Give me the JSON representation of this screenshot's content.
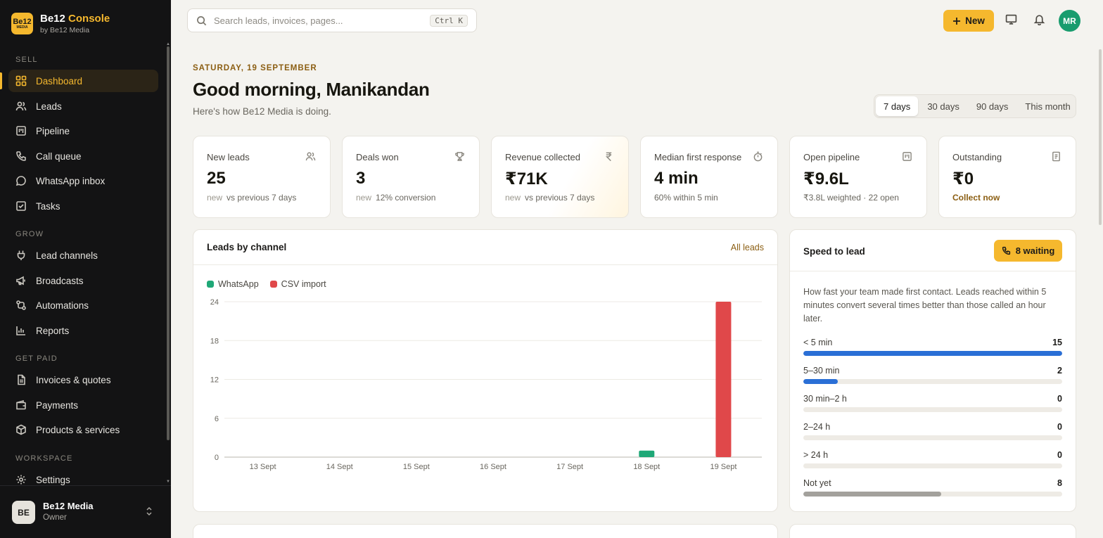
{
  "brand": {
    "name_prefix": "Be12",
    "name_suffix": "Console",
    "subtitle": "by Be12 Media",
    "logo_text": "Be12",
    "logo_subtext": "MEDIA"
  },
  "sidebar": {
    "sections": [
      {
        "label": "SELL"
      },
      {
        "label": "GROW"
      },
      {
        "label": "GET PAID"
      },
      {
        "label": "WORKSPACE"
      }
    ],
    "items": [
      {
        "label": "Dashboard",
        "icon": "grid-icon",
        "active": true
      },
      {
        "label": "Leads",
        "icon": "users-icon"
      },
      {
        "label": "Pipeline",
        "icon": "kanban-icon"
      },
      {
        "label": "Call queue",
        "icon": "phone-icon"
      },
      {
        "label": "WhatsApp inbox",
        "icon": "chat-bubble-icon"
      },
      {
        "label": "Tasks",
        "icon": "checkbox-icon"
      },
      {
        "label": "Lead channels",
        "icon": "plug-icon"
      },
      {
        "label": "Broadcasts",
        "icon": "megaphone-icon"
      },
      {
        "label": "Automations",
        "icon": "workflow-icon"
      },
      {
        "label": "Reports",
        "icon": "bar-chart-icon"
      },
      {
        "label": "Invoices & quotes",
        "icon": "document-icon"
      },
      {
        "label": "Payments",
        "icon": "wallet-icon"
      },
      {
        "label": "Products & services",
        "icon": "box-icon"
      },
      {
        "label": "Settings",
        "icon": "gear-icon"
      }
    ],
    "footer": {
      "avatar": "BE",
      "org": "Be12 Media",
      "role": "Owner"
    }
  },
  "topbar": {
    "search_placeholder": "Search leads, invoices, pages...",
    "shortcut": "Ctrl K",
    "new_label": "New",
    "avatar": "MR"
  },
  "header": {
    "date": "SATURDAY, 19 SEPTEMBER",
    "greeting": "Good morning, Manikandan",
    "subtitle": "Here's how Be12 Media is doing.",
    "ranges": [
      "7 days",
      "30 days",
      "90 days",
      "This month"
    ],
    "selected_range": "7 days"
  },
  "kpis": [
    {
      "title": "New leads",
      "value": "25",
      "note_muted": "new",
      "note": "vs previous 7 days",
      "icon": "users-icon"
    },
    {
      "title": "Deals won",
      "value": "3",
      "note_muted": "new",
      "note": "12% conversion",
      "icon": "trophy-icon"
    },
    {
      "title": "Revenue collected",
      "value": "₹71K",
      "note_muted": "new",
      "note": "vs previous 7 days",
      "icon": "rupee-icon"
    },
    {
      "title": "Median first response",
      "value": "4 min",
      "note_muted": "",
      "note": "60% within 5 min",
      "icon": "stopwatch-icon"
    },
    {
      "title": "Open pipeline",
      "value": "₹9.6L",
      "note_muted": "",
      "note": "₹3.8L weighted · 22 open",
      "icon": "kanban-icon"
    },
    {
      "title": "Outstanding",
      "value": "₹0",
      "note_muted": "",
      "note": "Collect now",
      "icon": "receipt-icon"
    }
  ],
  "leads_panel": {
    "title": "Leads by channel",
    "link": "All leads"
  },
  "chart_data": {
    "type": "bar",
    "categories": [
      "13 Sept",
      "14 Sept",
      "15 Sept",
      "16 Sept",
      "17 Sept",
      "18 Sept",
      "19 Sept"
    ],
    "series": [
      {
        "name": "WhatsApp",
        "color": "#1fa877",
        "values": [
          0,
          0,
          0,
          0,
          0,
          1,
          0
        ]
      },
      {
        "name": "CSV import",
        "color": "#e0484a",
        "values": [
          0,
          0,
          0,
          0,
          0,
          0,
          24
        ]
      }
    ],
    "yticks": [
      "0",
      "6",
      "12",
      "18",
      "24"
    ],
    "ylim": [
      0,
      24
    ],
    "grid": true,
    "legend": "top-left"
  },
  "speed_panel": {
    "title": "Speed to lead",
    "waiting_label": "8 waiting",
    "description": "How fast your team made first contact. Leads reached within 5 minutes convert several times better than those called an hour later.",
    "rows": [
      {
        "label": "< 5 min",
        "count": "15",
        "fraction": 1.0,
        "color": "#2a6fd6"
      },
      {
        "label": "5–30 min",
        "count": "2",
        "fraction": 0.133,
        "color": "#2a6fd6"
      },
      {
        "label": "30 min–2 h",
        "count": "0",
        "fraction": 0,
        "color": "#2a6fd6"
      },
      {
        "label": "2–24 h",
        "count": "0",
        "fraction": 0,
        "color": "#2a6fd6"
      },
      {
        "label": "> 24 h",
        "count": "0",
        "fraction": 0,
        "color": "#2a6fd6"
      },
      {
        "label": "Not yet",
        "count": "8",
        "fraction": 0.533,
        "color": "#a3a19c"
      }
    ]
  }
}
